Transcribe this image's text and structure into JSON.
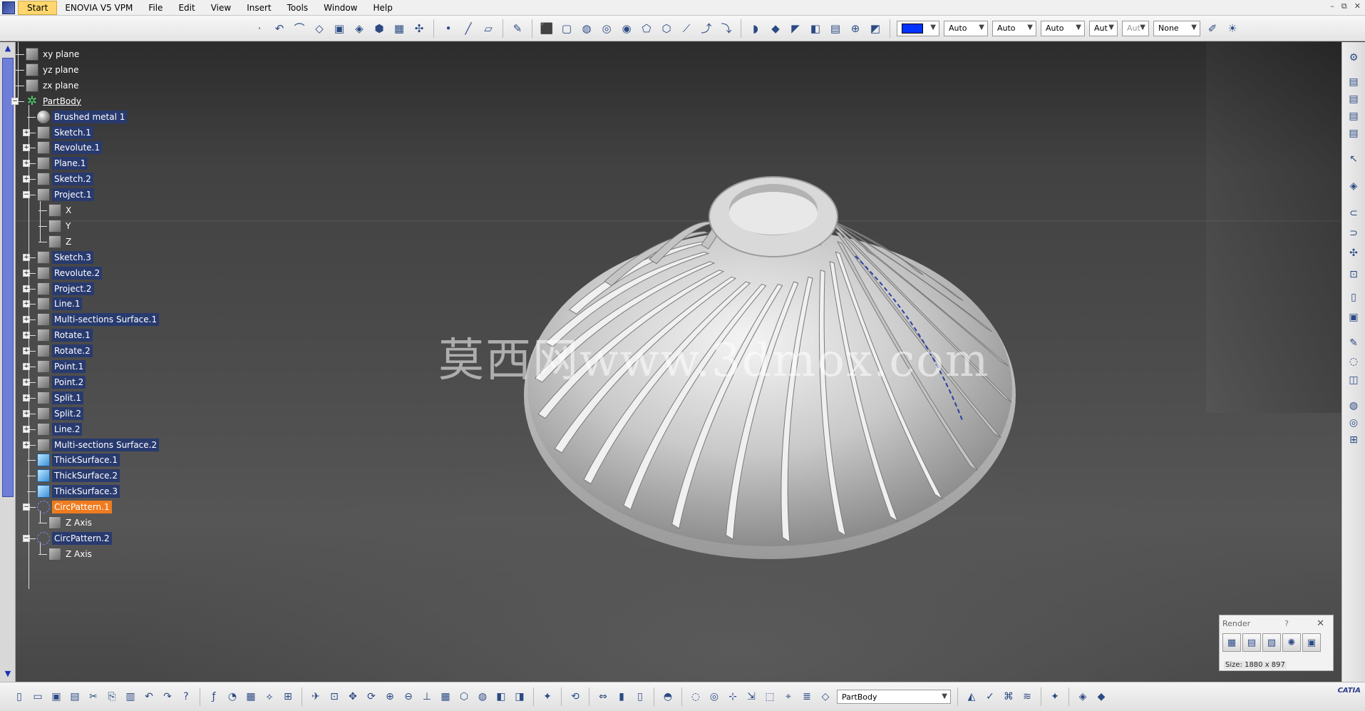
{
  "menubar": {
    "start": "Start",
    "app": "ENOVIA V5 VPM",
    "items": [
      "File",
      "Edit",
      "View",
      "Insert",
      "Tools",
      "Window",
      "Help"
    ]
  },
  "toolbar_top": {
    "color_swatch": "#0033ff",
    "combos": [
      "Auto",
      "Auto",
      "Auto",
      "Aut",
      "Aut",
      "None"
    ]
  },
  "tree": {
    "items": [
      {
        "label": "xy plane",
        "icon": "plane-icon"
      },
      {
        "label": "yz plane",
        "icon": "plane-icon"
      },
      {
        "label": "zx plane",
        "icon": "plane-icon"
      },
      {
        "label": "PartBody",
        "icon": "gear-icon"
      },
      {
        "label": "Brushed metal 1",
        "icon": "material-icon"
      },
      {
        "label": "Sketch.1",
        "icon": "sketch-icon"
      },
      {
        "label": "Revolute.1",
        "icon": "revolute-icon"
      },
      {
        "label": "Plane.1",
        "icon": "plane-icon"
      },
      {
        "label": "Sketch.2",
        "icon": "sketch-icon"
      },
      {
        "label": "Project.1",
        "icon": "project-icon"
      },
      {
        "label": "X",
        "icon": "point-icon"
      },
      {
        "label": "Y",
        "icon": "point-icon"
      },
      {
        "label": "Z",
        "icon": "point-icon"
      },
      {
        "label": "Sketch.3",
        "icon": "sketch-icon"
      },
      {
        "label": "Revolute.2",
        "icon": "revolute-icon"
      },
      {
        "label": "Project.2",
        "icon": "project-icon"
      },
      {
        "label": "Line.1",
        "icon": "line-icon"
      },
      {
        "label": "Multi-sections Surface.1",
        "icon": "surface-icon"
      },
      {
        "label": "Rotate.1",
        "icon": "rotate-icon"
      },
      {
        "label": "Rotate.2",
        "icon": "rotate-icon"
      },
      {
        "label": "Point.1",
        "icon": "point-icon"
      },
      {
        "label": "Point.2",
        "icon": "point-icon"
      },
      {
        "label": "Split.1",
        "icon": "split-icon"
      },
      {
        "label": "Split.2",
        "icon": "split-icon"
      },
      {
        "label": "Line.2",
        "icon": "line-icon"
      },
      {
        "label": "Multi-sections Surface.2",
        "icon": "surface-icon"
      },
      {
        "label": "ThickSurface.1",
        "icon": "thick-surface-icon"
      },
      {
        "label": "ThickSurface.2",
        "icon": "thick-surface-icon"
      },
      {
        "label": "ThickSurface.3",
        "icon": "thick-surface-icon"
      },
      {
        "label": "CircPattern.1",
        "icon": "circular-pattern-icon"
      },
      {
        "label": "Z Axis",
        "icon": "axis-icon"
      },
      {
        "label": "CircPattern.2",
        "icon": "circular-pattern-icon"
      },
      {
        "label": "Z Axis",
        "icon": "axis-icon"
      }
    ]
  },
  "viewport": {
    "watermark": "莫西网www.3dmox.com"
  },
  "render_panel": {
    "title": "Render",
    "help": "?",
    "size": "Size: 1880 x 897"
  },
  "toolbar_bottom": {
    "current_body": "PartBody"
  },
  "brand": {
    "logo_text": "CATIA"
  }
}
